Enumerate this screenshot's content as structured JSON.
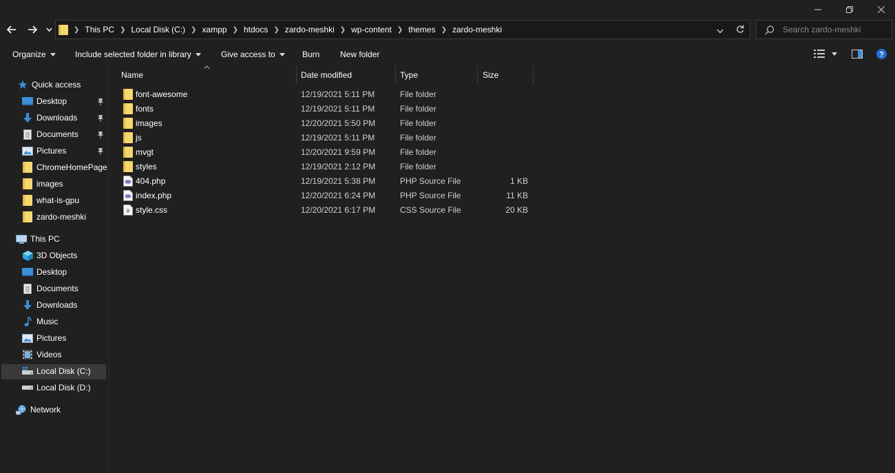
{
  "breadcrumb": [
    "This PC",
    "Local Disk (C:)",
    "xampp",
    "htdocs",
    "zardo-meshki",
    "wp-content",
    "themes",
    "zardo-meshki"
  ],
  "search": {
    "placeholder": "Search zardo-meshki"
  },
  "toolbar": {
    "organize": "Organize",
    "include_library": "Include selected folder in library",
    "give_access": "Give access to",
    "burn": "Burn",
    "new_folder": "New folder"
  },
  "nav": {
    "quick_access": "Quick access",
    "quick_items": [
      "Desktop",
      "Downloads",
      "Documents",
      "Pictures",
      "ChromeHomePage",
      "images",
      "what-is-gpu",
      "zardo-meshki"
    ],
    "this_pc": "This PC",
    "pc_items": [
      "3D Objects",
      "Desktop",
      "Documents",
      "Downloads",
      "Music",
      "Pictures",
      "Videos",
      "Local Disk (C:)",
      "Local Disk (D:)"
    ],
    "network": "Network"
  },
  "columns": {
    "name": "Name",
    "date": "Date modified",
    "type": "Type",
    "size": "Size"
  },
  "files": [
    {
      "name": "font-awesome",
      "date": "12/19/2021 5:11 PM",
      "type": "File folder",
      "size": "",
      "kind": "folder"
    },
    {
      "name": "fonts",
      "date": "12/19/2021 5:11 PM",
      "type": "File folder",
      "size": "",
      "kind": "folder"
    },
    {
      "name": "images",
      "date": "12/20/2021 5:50 PM",
      "type": "File folder",
      "size": "",
      "kind": "folder"
    },
    {
      "name": "js",
      "date": "12/19/2021 5:11 PM",
      "type": "File folder",
      "size": "",
      "kind": "folder"
    },
    {
      "name": "mvgt",
      "date": "12/20/2021 9:59 PM",
      "type": "File folder",
      "size": "",
      "kind": "folder"
    },
    {
      "name": "styles",
      "date": "12/19/2021 2:12 PM",
      "type": "File folder",
      "size": "",
      "kind": "folder"
    },
    {
      "name": "404.php",
      "date": "12/19/2021 5:38 PM",
      "type": "PHP Source File",
      "size": "1 KB",
      "kind": "php"
    },
    {
      "name": "index.php",
      "date": "12/20/2021 6:24 PM",
      "type": "PHP Source File",
      "size": "11 KB",
      "kind": "php"
    },
    {
      "name": "style.css",
      "date": "12/20/2021 6:17 PM",
      "type": "CSS Source File",
      "size": "20 KB",
      "kind": "css"
    }
  ],
  "colors": {
    "folder": "#f5d76e",
    "accent": "#3a8fd8",
    "selected": "#3a3a3a"
  }
}
